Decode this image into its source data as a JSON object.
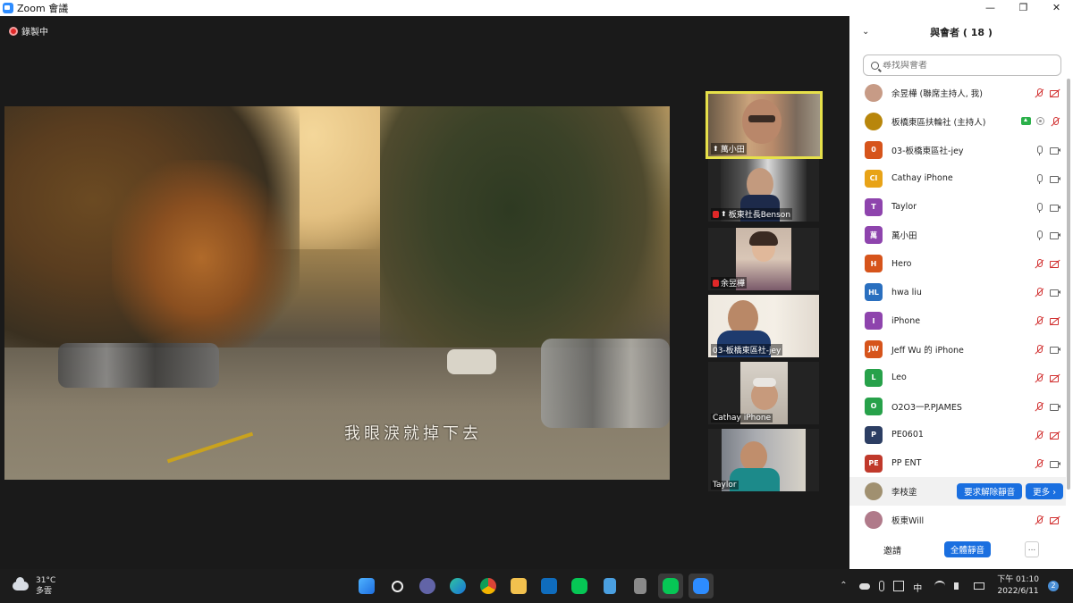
{
  "window": {
    "title": "Zoom 會議",
    "minimize": "—",
    "maximize": "❐",
    "close": "✕"
  },
  "meeting": {
    "recording_label": "錄製中",
    "subtitle": "我眼淚就掉下去",
    "gallery": [
      {
        "name": "萬小田",
        "pinned": true,
        "muted": false
      },
      {
        "name": "板東社長Benson",
        "pinned": true,
        "muted": true
      },
      {
        "name": "余昱樺",
        "pinned": false,
        "muted": true
      },
      {
        "name": "03-板橋東區社-jey",
        "pinned": false,
        "muted": false
      },
      {
        "name": "Cathay iPhone",
        "pinned": false,
        "muted": false
      },
      {
        "name": "Taylor",
        "pinned": false,
        "muted": false
      }
    ]
  },
  "panel": {
    "title": "與會者 ( 18 )",
    "search_placeholder": "尋找與會者",
    "participants": [
      {
        "name": "余昱樺 (聯席主持人, 我)",
        "avatar": "",
        "color": "#c79b86",
        "mic": "off",
        "cam": "off"
      },
      {
        "name": "板橋東區扶輪社 (主持人)",
        "avatar": "",
        "color": "#b8860b",
        "mic": "off",
        "cam": "none",
        "share": true,
        "rec": true
      },
      {
        "name": "03-板橋東區社-jey",
        "avatar": "0",
        "color": "#d6541b",
        "mic": "on",
        "cam": "on"
      },
      {
        "name": "Cathay iPhone",
        "avatar": "CI",
        "color": "#e8a317",
        "mic": "on",
        "cam": "on"
      },
      {
        "name": "Taylor",
        "avatar": "T",
        "color": "#8e44ad",
        "mic": "on",
        "cam": "on"
      },
      {
        "name": "萬小田",
        "avatar": "萬",
        "color": "#8e44ad",
        "mic": "on",
        "cam": "on"
      },
      {
        "name": "Hero",
        "avatar": "H",
        "color": "#d6541b",
        "mic": "off",
        "cam": "off"
      },
      {
        "name": "hwa liu",
        "avatar": "HL",
        "color": "#2a6fbf",
        "mic": "off",
        "cam": "on"
      },
      {
        "name": "iPhone",
        "avatar": "I",
        "color": "#8e44ad",
        "mic": "off",
        "cam": "off"
      },
      {
        "name": "Jeff Wu 的 iPhone",
        "avatar": "JW",
        "color": "#d6541b",
        "mic": "off",
        "cam": "on"
      },
      {
        "name": "Leo",
        "avatar": "L",
        "color": "#27a14a",
        "mic": "off",
        "cam": "off"
      },
      {
        "name": "O2O3一P.PJAMES",
        "avatar": "O",
        "color": "#27a14a",
        "mic": "off",
        "cam": "on"
      },
      {
        "name": "PE0601",
        "avatar": "P",
        "color": "#2c3e63",
        "mic": "off",
        "cam": "off"
      },
      {
        "name": "PP ENT",
        "avatar": "PE",
        "color": "#c0392b",
        "mic": "off",
        "cam": "on"
      },
      {
        "name": "李枝塗",
        "avatar": "",
        "color": "#a09070",
        "mic": "none",
        "cam": "none",
        "actions": true
      },
      {
        "name": "板東Will",
        "avatar": "",
        "color": "#b07a8a",
        "mic": "off",
        "cam": "off"
      }
    ],
    "ask_unmute_label": "要求解除靜音",
    "more_label": "更多 ›",
    "invite_label": "邀請",
    "mute_all_label": "全體靜音",
    "footer_more_label": "..."
  },
  "taskbar": {
    "temperature": "31°C",
    "weather": "多雲",
    "time": "下午 01:10",
    "date": "2022/6/11",
    "notifications": "2",
    "ime": "中"
  },
  "colors": {
    "zoom_blue": "#2d8cff",
    "button_blue": "#1a6fe0",
    "muted_red": "#d13030",
    "active_speaker": "#e6e04a"
  }
}
